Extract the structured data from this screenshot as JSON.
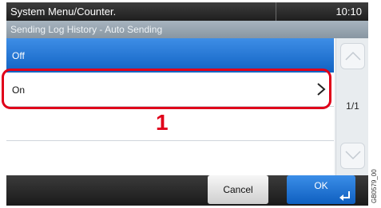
{
  "header": {
    "title": "System Menu/Counter.",
    "time": "10:10"
  },
  "subheader": {
    "title": "Sending Log History - Auto Sending"
  },
  "options": [
    {
      "label": "Off",
      "selected": true
    },
    {
      "label": "On",
      "selected": false,
      "has_submenu": true
    },
    {
      "label": ""
    },
    {
      "label": ""
    }
  ],
  "callout": {
    "number": "1"
  },
  "scroll": {
    "page_indicator": "1/1",
    "up_icon": "chevron-up-icon",
    "down_icon": "chevron-down-icon"
  },
  "footer": {
    "cancel_label": "Cancel",
    "ok_label": "OK",
    "ok_icon": "enter-icon"
  },
  "figure_id": "GB0579_00",
  "colors": {
    "selected_blue": "#1163c3",
    "highlight_red": "#e0001a"
  }
}
